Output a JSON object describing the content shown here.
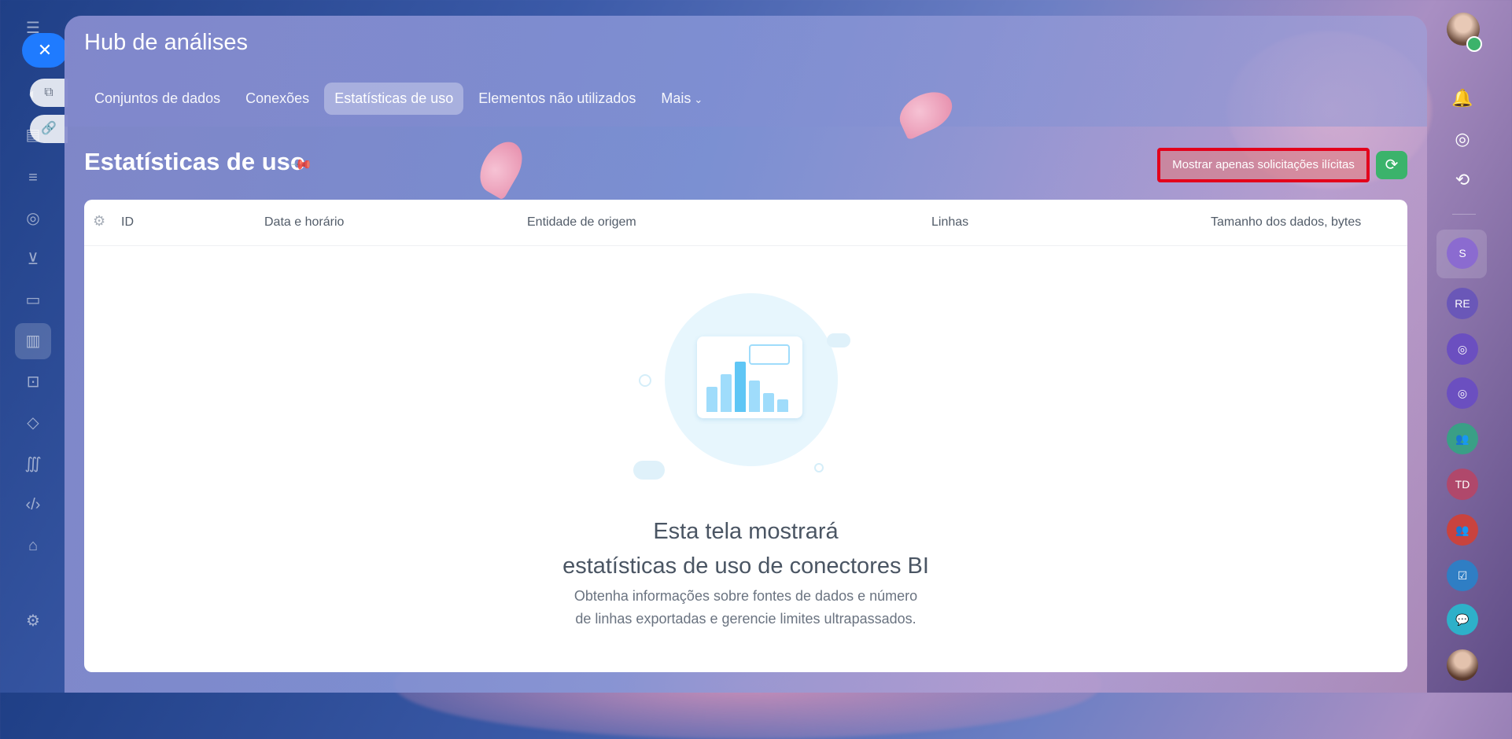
{
  "app": {
    "title": "Hub de análises",
    "tabs": [
      {
        "label": "Conjuntos de dados"
      },
      {
        "label": "Conexões"
      },
      {
        "label": "Estatísticas de uso"
      },
      {
        "label": "Elementos não utilizados"
      },
      {
        "label": "Mais"
      }
    ]
  },
  "page": {
    "title": "Estatísticas de uso",
    "illicit_button": "Mostrar apenas solicitações ilícitas",
    "refresh_icon": "refresh-icon"
  },
  "table": {
    "columns": [
      "ID",
      "Data e horário",
      "Entidade de origem",
      "Linhas",
      "Tamanho dos dados, bytes"
    ]
  },
  "empty_state": {
    "title_line1": "Esta tela mostrará",
    "title_line2": "estatísticas de uso de conectores BI",
    "subtitle_line1": "Obtenha informações sobre fontes de dados e número",
    "subtitle_line2": "de linhas exportadas e gerencie limites ultrapassados."
  },
  "right_sidebar": {
    "avatars": [
      "S",
      "RE",
      "TD"
    ]
  },
  "colors": {
    "accent_blue": "#1f7bff",
    "refresh_green": "#3bb36b",
    "highlight_red": "#e3001b"
  }
}
